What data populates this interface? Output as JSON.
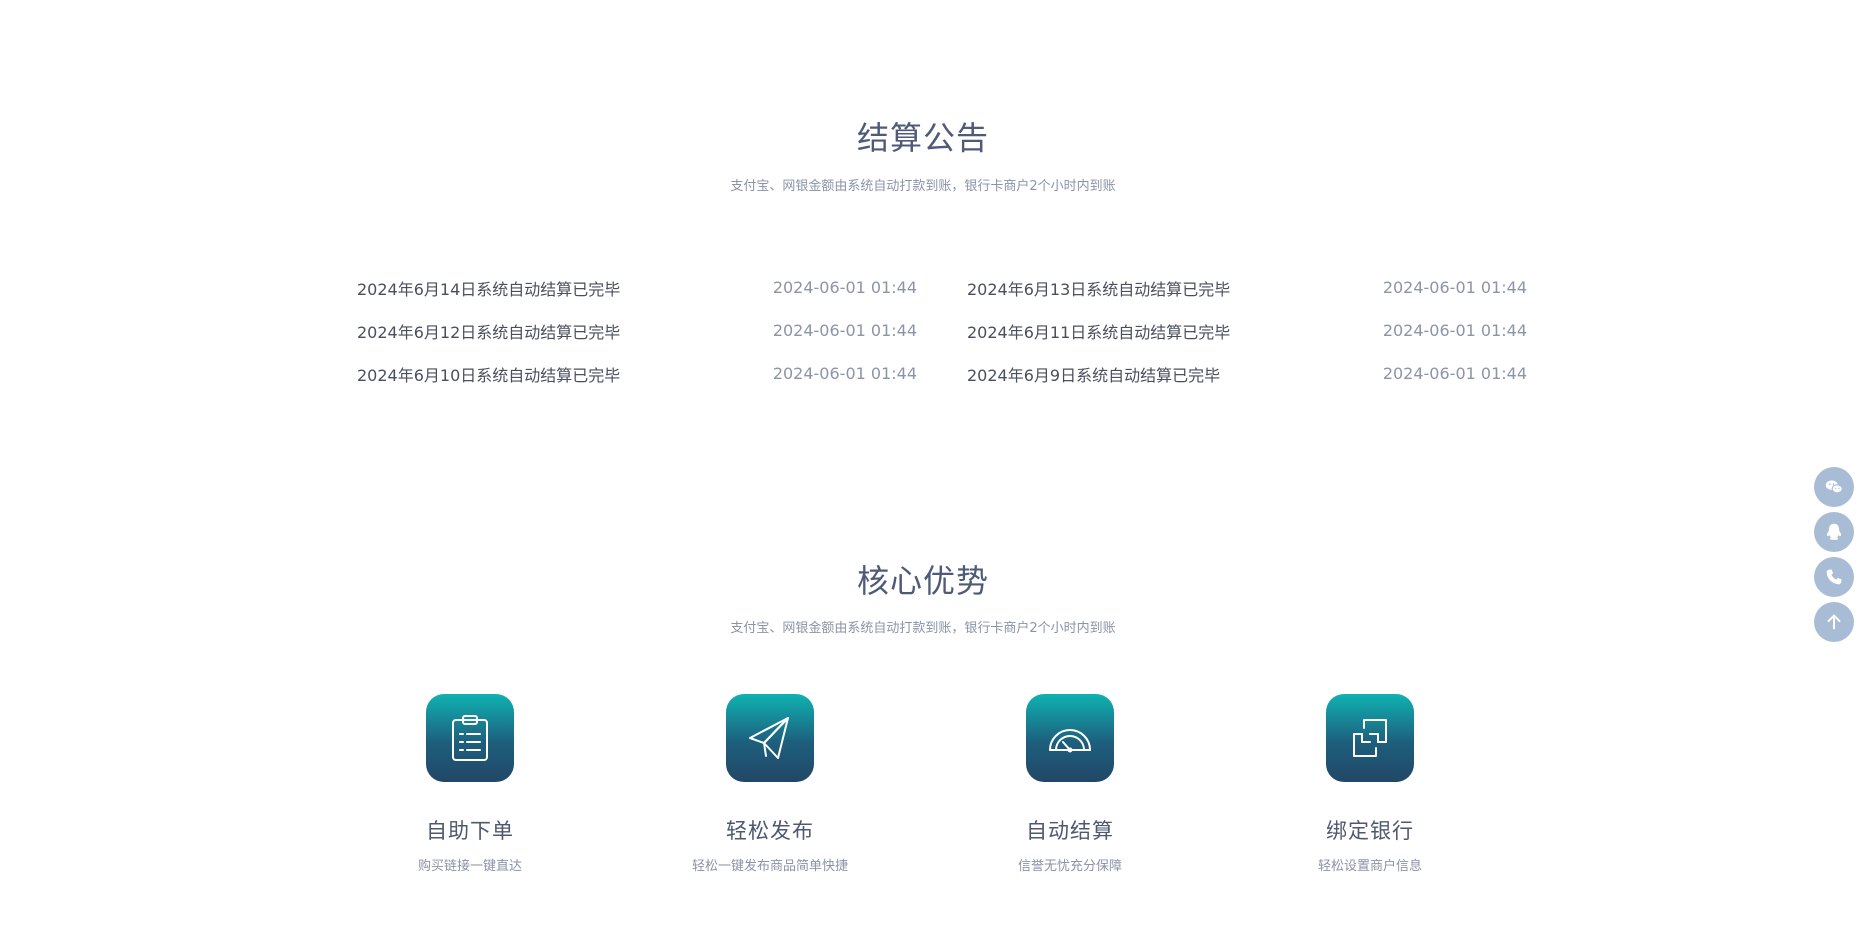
{
  "notice": {
    "title": "结算公告",
    "subtitle": "支付宝、网银金额由系统自动打款到账，银行卡商户2个小时内到账",
    "items": [
      {
        "text": "2024年6月14日系统自动结算已完毕",
        "date": "2024-06-01 01:44"
      },
      {
        "text": "2024年6月13日系统自动结算已完毕",
        "date": "2024-06-01 01:44"
      },
      {
        "text": "2024年6月12日系统自动结算已完毕",
        "date": "2024-06-01 01:44"
      },
      {
        "text": "2024年6月11日系统自动结算已完毕",
        "date": "2024-06-01 01:44"
      },
      {
        "text": "2024年6月10日系统自动结算已完毕",
        "date": "2024-06-01 01:44"
      },
      {
        "text": "2024年6月9日系统自动结算已完毕",
        "date": "2024-06-01 01:44"
      }
    ]
  },
  "advantages": {
    "title": "核心优势",
    "subtitle": "支付宝、网银金额由系统自动打款到账，银行卡商户2个小时内到账",
    "items": [
      {
        "name": "自助下单",
        "desc": "购买链接一键直达",
        "icon": "clipboard-list-icon"
      },
      {
        "name": "轻松发布",
        "desc": "轻松一键发布商品简单快捷",
        "icon": "paper-plane-icon"
      },
      {
        "name": "自动结算",
        "desc": "信誉无忧充分保障",
        "icon": "speedometer-icon"
      },
      {
        "name": "绑定银行",
        "desc": "轻松设置商户信息",
        "icon": "linked-squares-icon"
      }
    ]
  },
  "side_tools": [
    {
      "icon": "wechat-icon"
    },
    {
      "icon": "qq-icon"
    },
    {
      "icon": "phone-icon"
    },
    {
      "icon": "back-to-top-icon"
    }
  ],
  "colors": {
    "icon_gradient_top": "#0fb2b2",
    "icon_gradient_bottom": "#224766",
    "side_button": "#a9bcd6"
  }
}
